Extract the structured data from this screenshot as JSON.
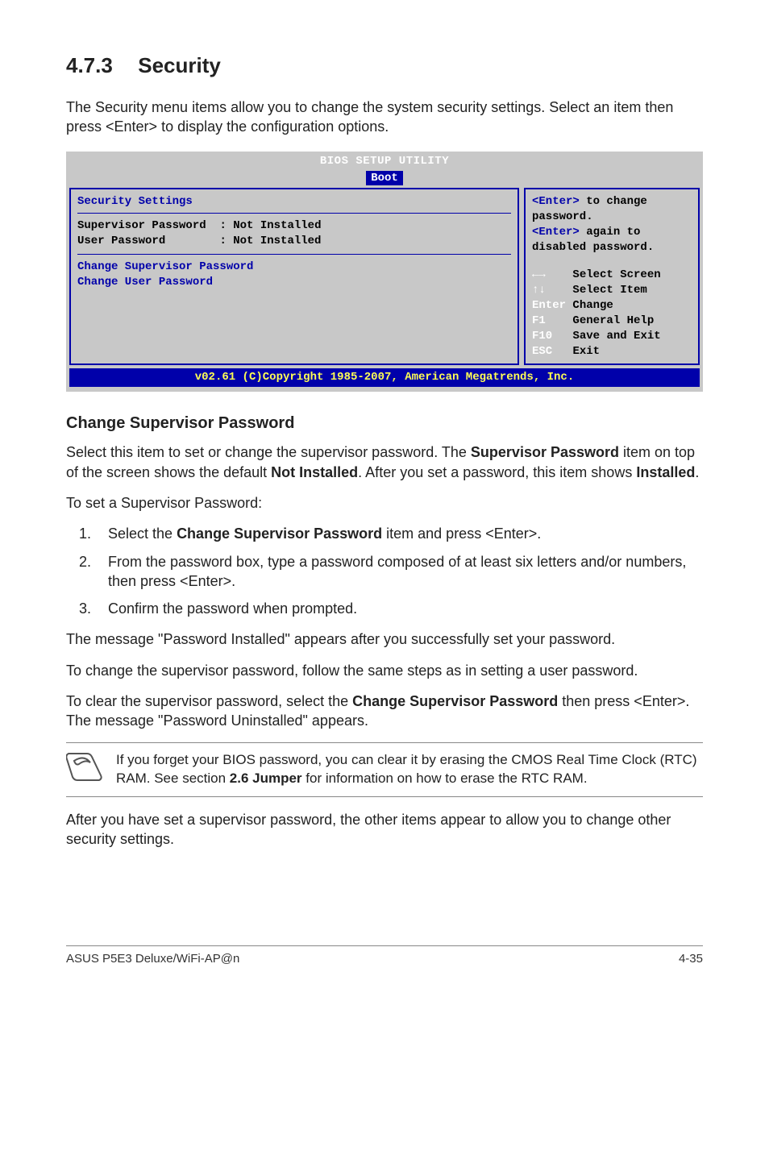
{
  "section": {
    "number": "4.7.3",
    "title": "Security"
  },
  "lead": "The Security menu items allow you to change the system security settings. Select an item then press <Enter> to display the configuration options.",
  "bios": {
    "title": "BIOS SETUP UTILITY",
    "tab": "Boot",
    "main_heading": "Security Settings",
    "rows": {
      "sup_pw_label": "Supervisor Password",
      "sup_pw_value": ": Not Installed",
      "usr_pw_label": "User Password",
      "usr_pw_value": ": Not Installed"
    },
    "options": {
      "opt1": "Change Supervisor Password",
      "opt2": "Change User Password"
    },
    "help": {
      "l1a": "<Enter>",
      "l1b": " to change",
      "l2": "password.",
      "l3a": "<Enter>",
      "l3b": " again to",
      "l4": "disabled password."
    },
    "nav": {
      "l1_key": "←→",
      "l1_desc": "Select Screen",
      "l2_key": "↑↓",
      "l2_desc": "Select Item",
      "l3_key": "Enter",
      "l3_desc": "Change",
      "l4_key": "F1",
      "l4_desc": "General Help",
      "l5_key": "F10",
      "l5_desc": "Save and Exit",
      "l6_key": "ESC",
      "l6_desc": "Exit"
    },
    "footer": "v02.61 (C)Copyright 1985-2007, American Megatrends, Inc."
  },
  "sub_heading": "Change Supervisor Password",
  "p1a": "Select this item to set or change the supervisor password. The ",
  "p1b": "Supervisor Password",
  "p1c": " item on top of the screen shows the default ",
  "p1d": "Not Installed",
  "p1e": ". After you set a password, this item shows ",
  "p1f": "Installed",
  "p1g": ".",
  "p2": "To set a Supervisor Password:",
  "steps": {
    "s1a": "Select the ",
    "s1b": "Change Supervisor Password",
    "s1c": " item and press <Enter>.",
    "s2": "From the password box, type a password composed of at least six letters and/or numbers, then press <Enter>.",
    "s3": "Confirm the password when prompted."
  },
  "p3": "The message \"Password Installed\" appears after you successfully set your password.",
  "p4": "To change the supervisor password, follow the same steps as in setting a user password.",
  "p5a": "To clear the supervisor password, select the ",
  "p5b": "Change Supervisor Password",
  "p5c": " then press <Enter>. The message \"Password Uninstalled\" appears.",
  "note": {
    "t1": "If you forget your BIOS password, you can clear it by erasing the CMOS Real Time Clock (RTC) RAM. See section ",
    "t2": "2.6 Jumper",
    "t3": " for information on how to erase the RTC RAM."
  },
  "p6": "After you have set a supervisor password, the other items appear to allow you to change other security settings.",
  "page_footer": {
    "left": "ASUS P5E3 Deluxe/WiFi-AP@n",
    "right": "4-35"
  }
}
